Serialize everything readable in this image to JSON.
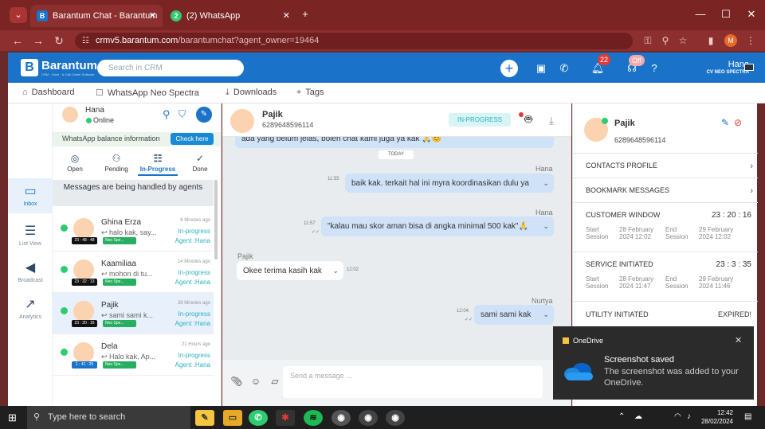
{
  "browser": {
    "tabs": [
      {
        "label": "Barantum Chat - Barantum CRM",
        "icon": "B",
        "active": true
      },
      {
        "label": "(2) WhatsApp",
        "icon": "2",
        "active": false
      }
    ],
    "url_host": "crmv5.barantum.com",
    "url_path": "/barantumchat?agent_owner=19464",
    "profile_letter": "M"
  },
  "app": {
    "brand": "Barantum",
    "brand_sub": "CRM · Omni · & Call Center Software",
    "search_placeholder": "Search in CRM",
    "notif_count": "22",
    "off_badge": "Off",
    "user_name": "Hana",
    "company": "CV NEO SPECTRA",
    "nav": [
      {
        "label": "Dashboard",
        "icon": "⌂"
      },
      {
        "label": "WhatsApp Neo Spectra",
        "icon": "☐"
      },
      {
        "label": "Downloads",
        "icon": "⤓"
      },
      {
        "label": "Tags",
        "icon": "⌖"
      }
    ]
  },
  "rail": [
    {
      "label": "Inbox",
      "icon": "▭"
    },
    {
      "label": "List View",
      "icon": "☰"
    },
    {
      "label": "Broadcast",
      "icon": "◀"
    },
    {
      "label": "Analytics",
      "icon": "↗"
    }
  ],
  "agent": {
    "name": "Hana",
    "status": "Online",
    "balance_text": "WhatsApp balance information",
    "check_label": "Check here"
  },
  "filter_tabs": [
    {
      "label": "Open",
      "icon": "◎"
    },
    {
      "label": "Pending",
      "icon": "⚇"
    },
    {
      "label": "In-Progress",
      "icon": "☷"
    },
    {
      "label": "Done",
      "icon": "✓"
    }
  ],
  "handled_banner": "Messages are being handled by agents",
  "conversations": [
    {
      "name": "Ghina Erza",
      "msg": "halo kak, say...",
      "ago": "6 Minutes ago",
      "status": "In-progress",
      "agent": "Agent :Hana",
      "timer": "23 : 48 : 48",
      "channel": "Neo Spe..."
    },
    {
      "name": "Kaamiliaa",
      "msg": "mohon di tu...",
      "ago": "14 Minutes ago",
      "status": "In-progress",
      "agent": "Agent :Hana",
      "timer": "23 : 32 : 13",
      "channel": "Neo Spe..."
    },
    {
      "name": "Pajik",
      "msg": "sami sami k...",
      "ago": "38 Minutes ago",
      "status": "In-progress",
      "agent": "Agent :Hana",
      "timer": "23 : 20 : 16",
      "channel": "Neo Spe..."
    },
    {
      "name": "Dela",
      "msg": "Halo kak, Ap...",
      "ago": "21 Hours ago",
      "status": "In-progress",
      "agent": "Agent :Hana",
      "timer": "1 : 41 : 25",
      "channel": "Neo Spe..."
    }
  ],
  "chat": {
    "name": "Pajik",
    "phone": "6289648596114",
    "status": "IN-PROGRESS",
    "today": "TODAY",
    "messages": [
      {
        "text": "ada yang belum jelas, boleh chat kami juga ya kak 🙏😊",
        "dir": "out",
        "sender": "",
        "time": ""
      },
      {
        "text": "baik kak. terkait hal ini myra koordinasikan dulu ya",
        "dir": "out",
        "sender": "Hana",
        "time": "11:55"
      },
      {
        "text": "\"kalau mau skor aman bisa di angka minimal 500 kak\"🙏",
        "dir": "out",
        "sender": "Hana",
        "time": "11:57"
      },
      {
        "text": "Okee terima kasih kak",
        "dir": "in",
        "sender": "Pajik",
        "time": "12:02"
      },
      {
        "text": "sami sami kak",
        "dir": "out",
        "sender": "Nurtya",
        "time": "12:04"
      }
    ],
    "composer_placeholder": "Send a message ..."
  },
  "contact_panel": {
    "name": "Pajik",
    "phone": "6289648596114",
    "contacts_profile": "CONTACTS PROFILE",
    "bookmark": "BOOKMARK MESSAGES",
    "customer_window": {
      "title": "CUSTOMER WINDOW",
      "clock": "23 : 20 : 16",
      "start_label": "Start Session",
      "start": "28 February 2024 12:02",
      "end_label": "End Session",
      "end": "29 February 2024 12:02"
    },
    "service_initiated": {
      "title": "SERVICE INITIATED",
      "clock": "23 : 3 : 35",
      "start_label": "Start Session",
      "start": "28 February 2024 11:47",
      "end_label": "End Session",
      "end": "29 February 2024 11:46"
    },
    "utility_initiated": {
      "title": "UTILITY INITIATED",
      "value": "EXPIRED!"
    }
  },
  "toast": {
    "app": "OneDrive",
    "title": "Screenshot saved",
    "body": "The screenshot was added to your OneDrive."
  },
  "taskbar": {
    "search": "Type here to search",
    "time": "12:42",
    "date": "28/02/2024"
  },
  "colors": {
    "brand_blue": "#1a73c8",
    "browser_red": "#8e2f2f",
    "status_teal": "#2bb3c0",
    "whatsapp_green": "#2ecc71"
  }
}
